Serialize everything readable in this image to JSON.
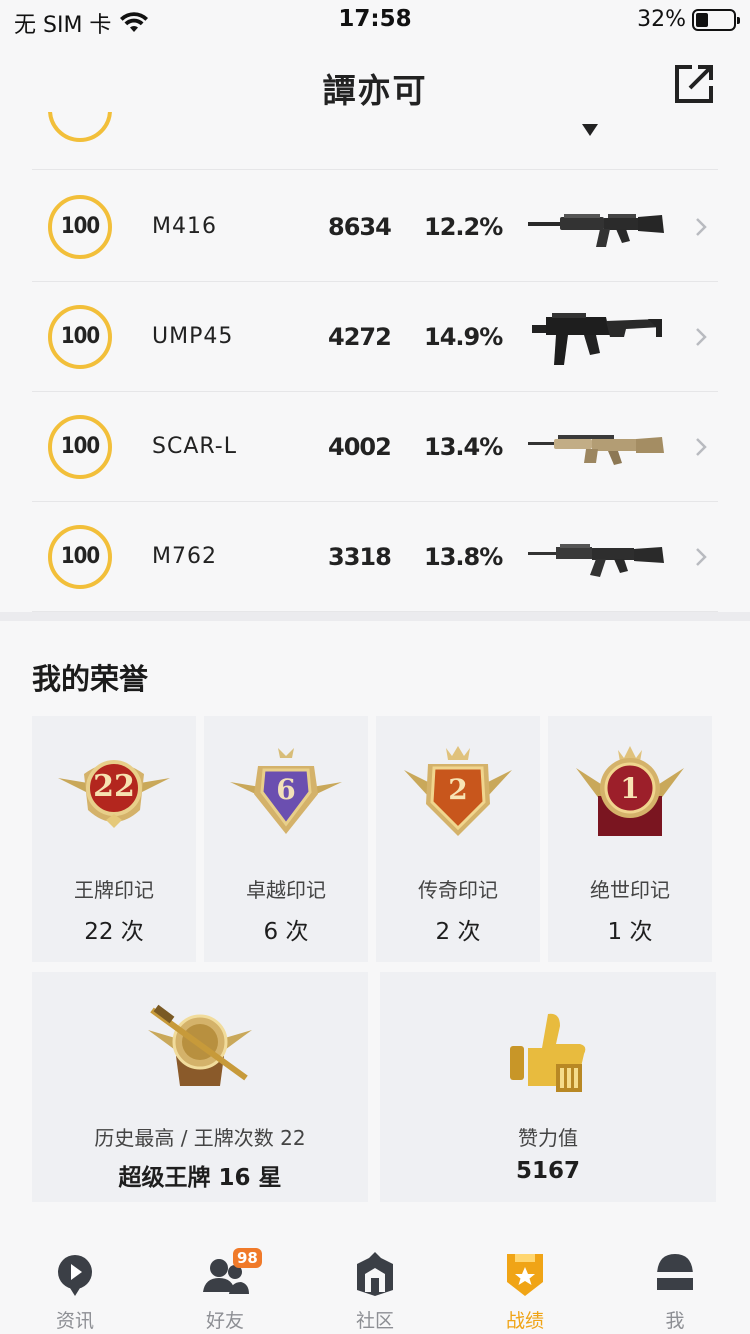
{
  "status_bar": {
    "carrier": "无 SIM 卡",
    "time": "17:58",
    "battery_percent": "32%",
    "battery_level": 0.32
  },
  "nav": {
    "title": "譚亦可",
    "share_icon": "share-external-icon"
  },
  "weapons": [
    {
      "score": "100",
      "name": "M416",
      "kills": "8634",
      "rate": "12.2%",
      "icon": "m416-rifle-image"
    },
    {
      "score": "100",
      "name": "UMP45",
      "kills": "4272",
      "rate": "14.9%",
      "icon": "ump45-smg-image"
    },
    {
      "score": "100",
      "name": "SCAR-L",
      "kills": "4002",
      "rate": "13.4%",
      "icon": "scar-l-rifle-image"
    },
    {
      "score": "100",
      "name": "M762",
      "kills": "3318",
      "rate": "13.8%",
      "icon": "m762-rifle-image"
    }
  ],
  "honors": {
    "title": "我的荣誉",
    "marks": [
      {
        "badge_number": "22",
        "label": "王牌印记",
        "value": "22 次",
        "color": "#b3261e"
      },
      {
        "badge_number": "6",
        "label": "卓越印记",
        "value": "6 次",
        "color": "#6b4fb0"
      },
      {
        "badge_number": "2",
        "label": "传奇印记",
        "value": "2 次",
        "color": "#c8561c"
      },
      {
        "badge_number": "1",
        "label": "绝世印记",
        "value": "1 次",
        "color": "#9c1f2a"
      }
    ],
    "highest": {
      "label": "历史最高 / 王牌次数 22",
      "value": "超级王牌 16 星"
    },
    "likes": {
      "label": "赞力值",
      "value": "5167"
    }
  },
  "tabs": [
    {
      "label": "资讯",
      "icon": "news-play-icon",
      "active": false
    },
    {
      "label": "好友",
      "icon": "friends-icon",
      "badge": "98",
      "active": false
    },
    {
      "label": "社区",
      "icon": "community-house-icon",
      "active": false
    },
    {
      "label": "战绩",
      "icon": "record-shield-icon",
      "active": true
    },
    {
      "label": "我",
      "icon": "helmet-profile-icon",
      "active": false
    }
  ],
  "colors": {
    "accent": "#f0a416",
    "ring": "#f2bf3a",
    "card_bg": "#eff0f3"
  }
}
